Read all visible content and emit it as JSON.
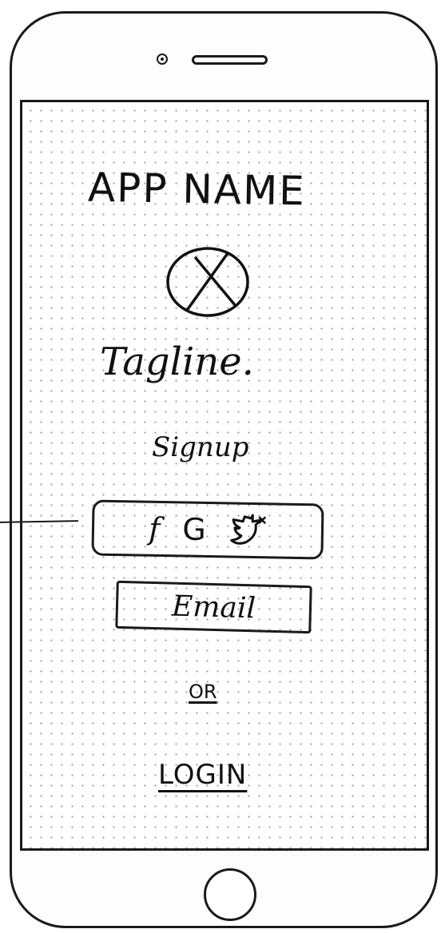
{
  "app": {
    "name": "APP NAME",
    "logo_icon": "x-placeholder-icon",
    "tagline": "Tagline."
  },
  "signup": {
    "heading": "Signup",
    "social": {
      "facebook_glyph": "f",
      "google_glyph": "G",
      "twitter_icon": "twitter-bird-icon"
    },
    "email_label": "Email"
  },
  "divider": {
    "or_label": "OR"
  },
  "login": {
    "label": "LOGIN"
  }
}
